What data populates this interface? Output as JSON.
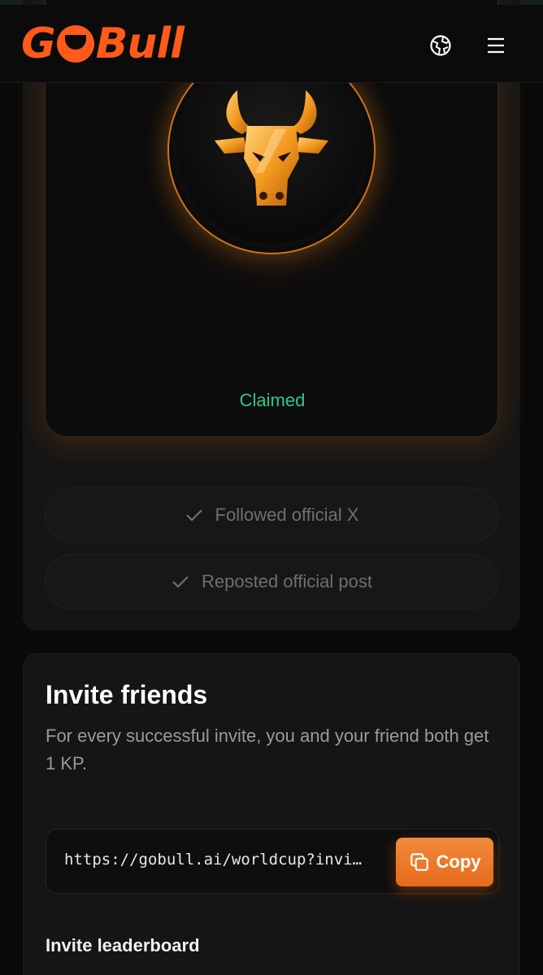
{
  "header": {
    "logo_text": "GOBull",
    "globe_icon": "globe-icon",
    "menu_icon": "hamburger-menu-icon"
  },
  "nft_card": {
    "status": "Claimed",
    "status_color": "#2fc88a",
    "emblem_icon": "bull-head-icon"
  },
  "tasks": [
    {
      "label": "Followed official X",
      "icon": "check-icon"
    },
    {
      "label": "Reposted official post",
      "icon": "check-icon"
    }
  ],
  "invite": {
    "title": "Invite friends",
    "description": "For every successful invite, you and your friend both get 1 KP.",
    "link": "https://gobull.ai/worldcup?invi…",
    "copy_label": "Copy",
    "copy_icon": "copy-icon",
    "leaderboard_title": "Invite leaderboard"
  },
  "colors": {
    "brand": "#ff5a1a",
    "button": "#ef7a2b",
    "background": "#0a0a0a"
  }
}
